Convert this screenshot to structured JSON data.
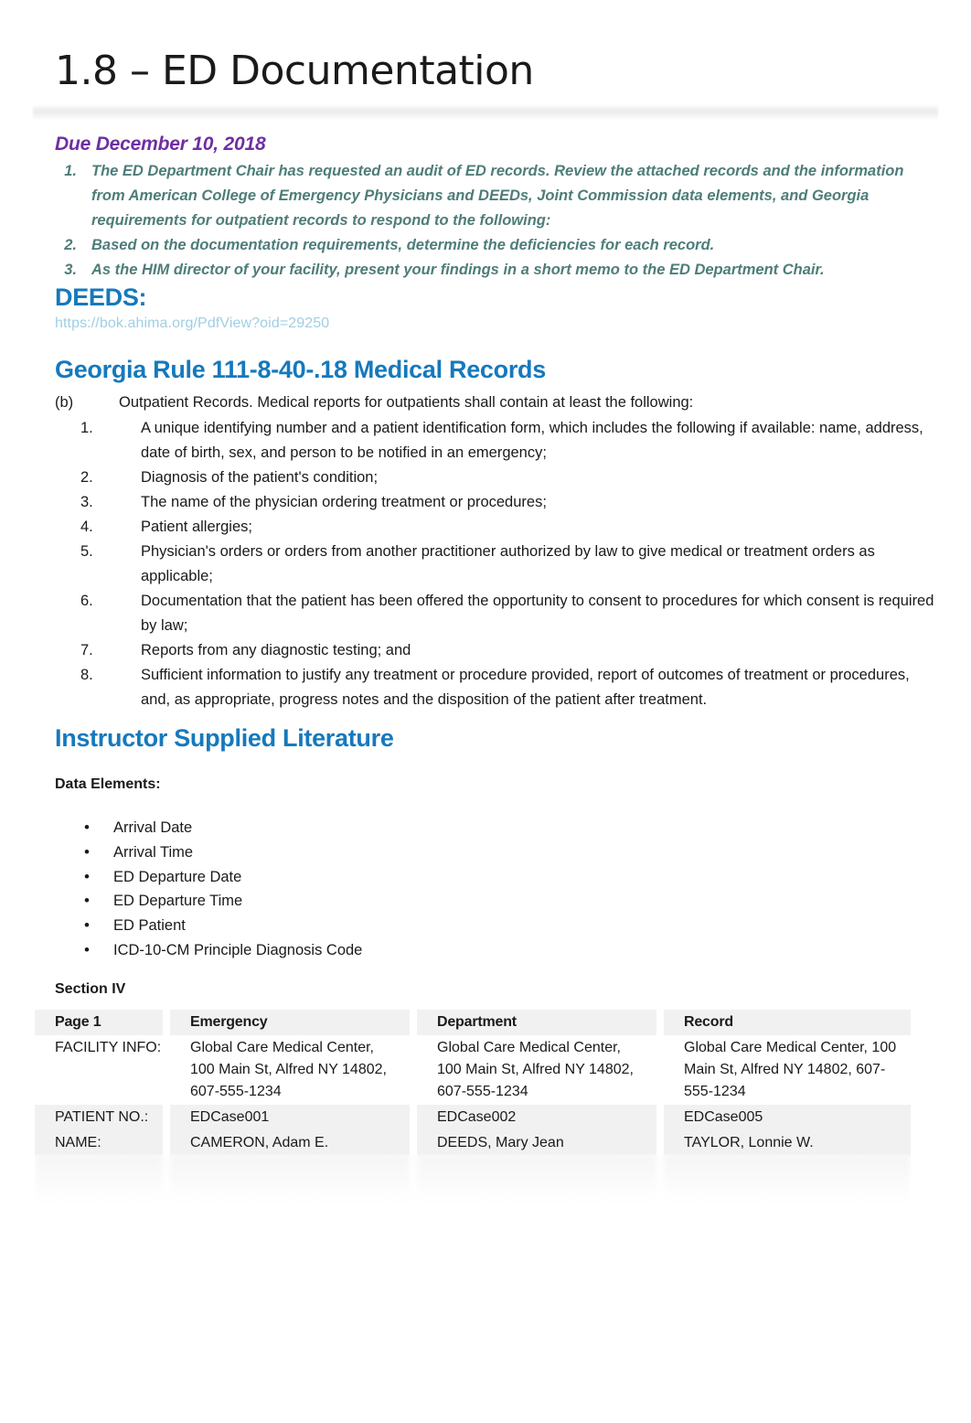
{
  "document": {
    "title": "1.8 – ED Documentation",
    "due_line": "Due December 10, 2018"
  },
  "assignment": {
    "items": [
      {
        "num": "1.",
        "text": "The ED Department Chair has requested an audit of ED records. Review the attached records and the information from American College of Emergency Physicians and DEEDs, Joint Commission data elements, and Georgia requirements for outpatient records to respond to the following:"
      },
      {
        "num": "2.",
        "text": "Based on the documentation requirements, determine the deficiencies for each record."
      },
      {
        "num": "3.",
        "text": "As the HIM director of your facility, present your findings in a short memo to the ED Department Chair."
      }
    ]
  },
  "deeds": {
    "heading": "DEEDS:",
    "url": "https://bok.ahima.org/PdfView?oid=29250"
  },
  "georgia": {
    "heading": "Georgia Rule 111-8-40-.18 Medical Records",
    "subsection_label": "(b)",
    "subsection_text": "Outpatient Records. Medical reports for outpatients shall contain at least the following:",
    "items": [
      {
        "num": "1.",
        "text": "A unique identifying number and a patient identification form, which includes the following if available: name, address, date of birth, sex, and person to be notified in an emergency;"
      },
      {
        "num": "2.",
        "text": "Diagnosis of the patient's condition;"
      },
      {
        "num": "3.",
        "text": "The name of the physician ordering treatment or procedures;"
      },
      {
        "num": "4.",
        "text": "Patient allergies;"
      },
      {
        "num": "5.",
        "text": "Physician's orders or orders from another practitioner authorized by law to give medical or treatment orders as applicable;"
      },
      {
        "num": "6.",
        "text": "Documentation that the patient has been offered the opportunity to consent to procedures for which consent is required by law;"
      },
      {
        "num": "7.",
        "text": "Reports from any diagnostic testing; and"
      },
      {
        "num": "8.",
        "text": "Sufficient information to justify any treatment or procedure provided, report of outcomes of treatment or procedures, and, as appropriate, progress notes and the disposition of the patient after treatment."
      }
    ]
  },
  "instructor": {
    "heading": "Instructor Supplied Literature",
    "data_elements_label": "Data Elements:",
    "bullet_char": "•",
    "data_elements": [
      "Arrival Date",
      "Arrival Time",
      "ED Departure Date",
      "ED Departure Time",
      "ED Patient",
      "ICD-10-CM Principle Diagnosis Code"
    ]
  },
  "section": {
    "label": "Section IV"
  },
  "record_table": {
    "headers": [
      "Page 1",
      "Emergency",
      "Department",
      "Record"
    ],
    "rows": [
      {
        "label": "FACILITY INFO:",
        "values": [
          "Global Care Medical Center, 100 Main St, Alfred NY 14802, 607-555-1234",
          "Global Care Medical Center, 100 Main St, Alfred NY 14802, 607-555-1234",
          "Global Care Medical Center, 100 Main St, Alfred NY 14802, 607-555-1234"
        ]
      },
      {
        "label": "PATIENT NO.:",
        "values": [
          "EDCase001",
          "EDCase002",
          "EDCase005"
        ]
      },
      {
        "label": "NAME:",
        "values": [
          "CAMERON, Adam E.",
          "DEEDS, Mary Jean",
          "TAYLOR, Lonnie W."
        ]
      }
    ]
  },
  "colors": {
    "heading_blue": "#1579bd",
    "table_header_blue": "#19a8e8",
    "due_purple": "#6f2fa2",
    "list_teal": "#4e7d79",
    "link_light_blue": "#9fcfe3",
    "cell_shade": "#f1f1f1"
  }
}
